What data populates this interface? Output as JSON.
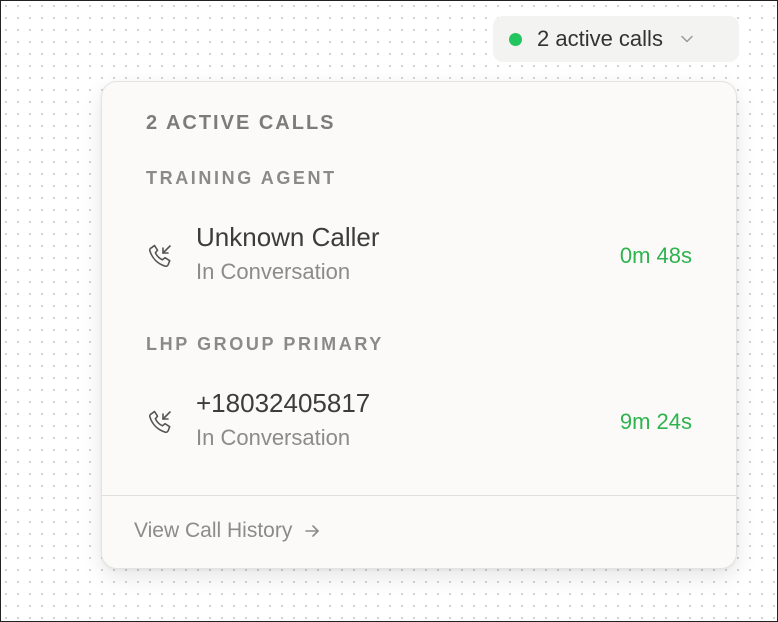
{
  "status_pill": {
    "label": "2 active calls",
    "dot_color": "#22c55e",
    "dot_icon": "status-dot",
    "chevron_icon": "chevron-down-icon"
  },
  "panel": {
    "heading": "2 ACTIVE CALLS",
    "groups": [
      {
        "title": "TRAINING AGENT",
        "calls": [
          {
            "icon": "incoming-call-icon",
            "caller": "Unknown Caller",
            "status": "In Conversation",
            "duration": "0m 48s"
          }
        ]
      },
      {
        "title": "LHP GROUP PRIMARY",
        "calls": [
          {
            "icon": "incoming-call-icon",
            "caller": "+18032405817",
            "status": "In Conversation",
            "duration": "9m 24s"
          }
        ]
      }
    ],
    "footer": {
      "link_label": "View Call History",
      "link_icon": "arrow-right-icon"
    }
  },
  "colors": {
    "active_green": "#2eb34f",
    "muted_text": "#8b8b8b",
    "panel_bg": "#fbfaf8"
  }
}
